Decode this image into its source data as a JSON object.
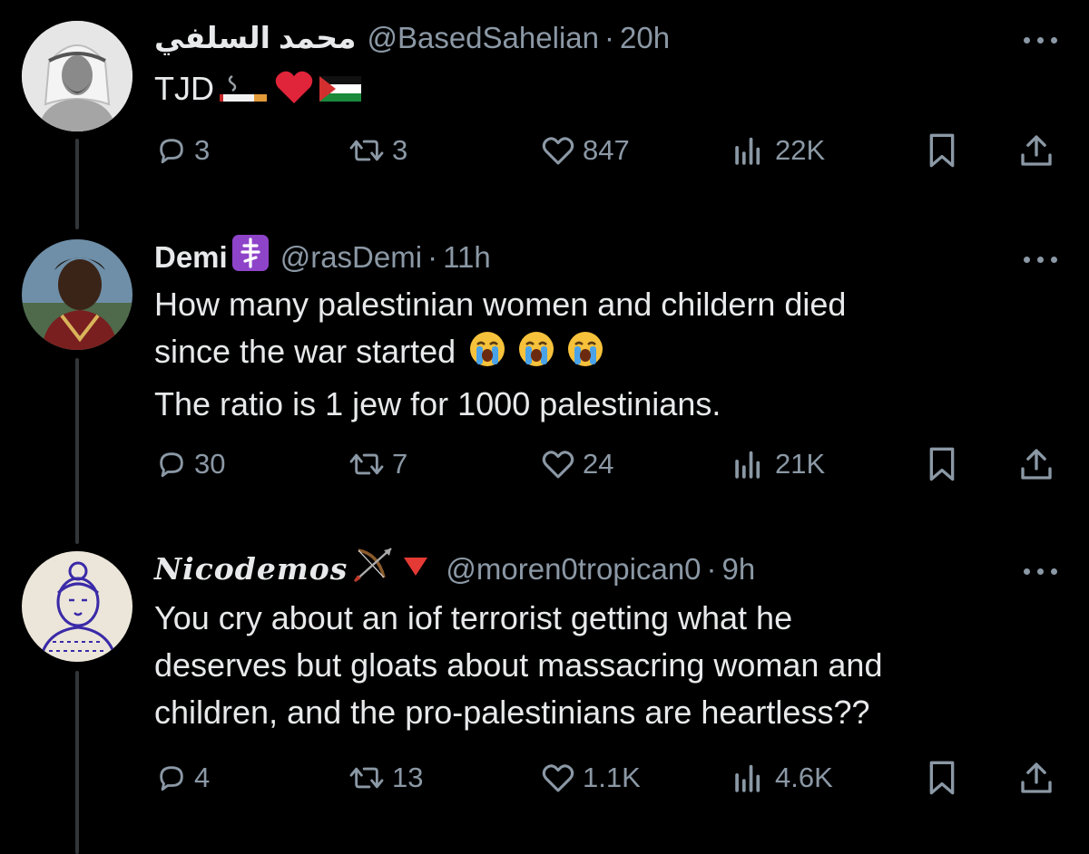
{
  "tweets": [
    {
      "display_name": "محمد السلفي",
      "handle": "@BasedSahelian",
      "time": "20h",
      "text_lines": [
        "TJD"
      ],
      "text_emojis": [
        "cigarette-emoji",
        "red-heart-emoji",
        "palestine-flag-emoji"
      ],
      "replies": "3",
      "reposts": "3",
      "likes": "847",
      "views": "22K"
    },
    {
      "display_name": "Demi",
      "name_badge": "orthodox-cross-emoji",
      "handle": "@rasDemi",
      "time": "11h",
      "text_lines": [
        "How many palestinian women and childern died",
        "since the war started",
        "The ratio is 1 jew for 1000 palestinians."
      ],
      "text_emojis": [
        "loudly-crying-face-emoji",
        "loudly-crying-face-emoji",
        "loudly-crying-face-emoji"
      ],
      "replies": "30",
      "reposts": "7",
      "likes": "24",
      "views": "21K"
    },
    {
      "display_name": "Nicodemos",
      "name_badges": [
        "bow-and-arrow-emoji",
        "red-triangle-emoji"
      ],
      "handle": "@moren0tropican0",
      "time": "9h",
      "text_lines": [
        "You cry about an iof terrorist getting what he",
        "deserves but gloats about massacring woman and",
        "children, and the pro-palestinians are heartless??"
      ],
      "replies": "4",
      "reposts": "13",
      "likes": "1.1K",
      "views": "4.6K"
    }
  ],
  "separator": "·",
  "colors": {
    "background": "#000000",
    "text": "#e7e9ea",
    "secondary": "#8b98a5",
    "thread_line": "#333639"
  }
}
